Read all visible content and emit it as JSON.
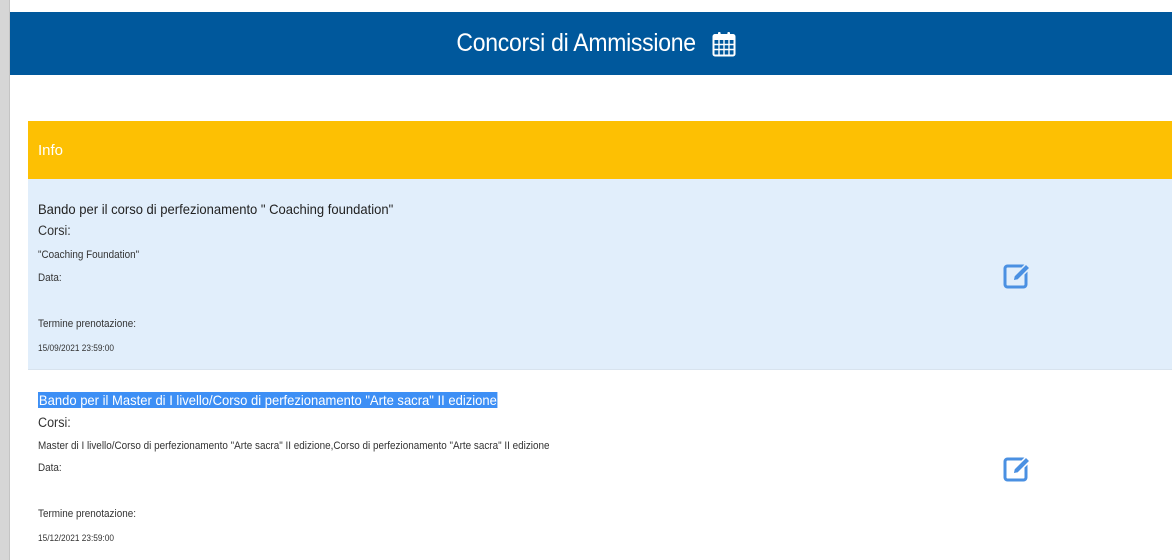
{
  "header": {
    "title": "Concorsi di Ammissione",
    "icon": "calendar-icon",
    "background": "#00589c"
  },
  "info": {
    "label": "Info",
    "background": "#fdc003"
  },
  "entries": [
    {
      "title": "Bando per il corso di perfezionamento \" Coaching foundation\"",
      "courses_label": "Corsi:",
      "courses": "\"Coaching Foundation\"",
      "date_label": "Data:",
      "deadline_label": "Termine prenotazione:",
      "deadline": "15/09/2021 23:59:00",
      "edit_icon": "edit-icon"
    },
    {
      "title": "Bando per il Master di I livello/Corso di perfezionamento \"Arte sacra\" II edizione",
      "courses_label": "Corsi:",
      "courses": "Master di I livello/Corso di perfezionamento \"Arte sacra\" II edizione,Corso di perfezionamento \"Arte sacra\" II edizione",
      "date_label": "Data:",
      "deadline_label": "Termine prenotazione:",
      "deadline": "15/12/2021 23:59:00",
      "edit_icon": "edit-icon"
    }
  ],
  "colors": {
    "accent": "#3d8ff5",
    "entry_highlight": "#e1eefb",
    "edit_icon": "#4a90e2"
  }
}
